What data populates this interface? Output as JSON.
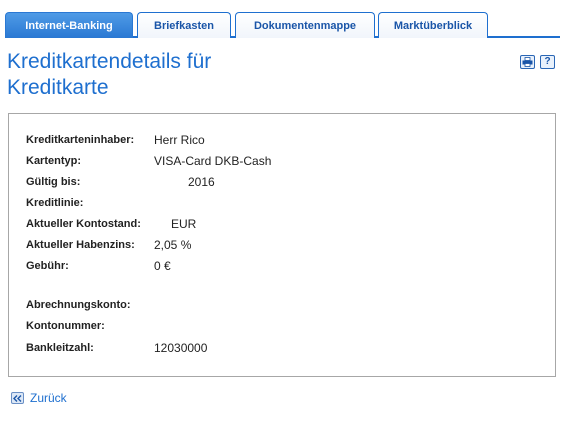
{
  "tabs": [
    {
      "label": "Internet-Banking",
      "active": true
    },
    {
      "label": "Briefkasten",
      "active": false
    },
    {
      "label": "Dokumentenmappe",
      "active": false
    },
    {
      "label": "Marktüberblick",
      "active": false
    }
  ],
  "page": {
    "title": "Kreditkartendetails für Kreditkarte"
  },
  "toolbar": {
    "icons": [
      "printer-icon",
      "help-icon"
    ],
    "help_glyph": "?"
  },
  "details": [
    {
      "label": "Kreditkarteninhaber:",
      "value": "Herr Rico"
    },
    {
      "label": "Kartentyp:",
      "value": "VISA-Card DKB-Cash"
    },
    {
      "label": "Gültig bis:",
      "value": "2016"
    },
    {
      "label": "Kreditlinie:",
      "value": ""
    },
    {
      "label": "Aktueller Kontostand:",
      "value": "EUR"
    },
    {
      "label": "Aktueller Habenzins:",
      "value": "2,05 %"
    },
    {
      "label": "Gebühr:",
      "value": "0 €"
    },
    {
      "label": "Abrechnungskonto:",
      "value": ""
    },
    {
      "label": "Kontonummer:",
      "value": ""
    },
    {
      "label": "Bankleitzahl:",
      "value": "12030000"
    }
  ],
  "back": {
    "label": "Zurück",
    "icon": "double-chevron-left-icon"
  },
  "colors": {
    "accent": "#1e6fcf",
    "tab_active": "#2a78d3",
    "panel_border": "#a7a7a7"
  }
}
